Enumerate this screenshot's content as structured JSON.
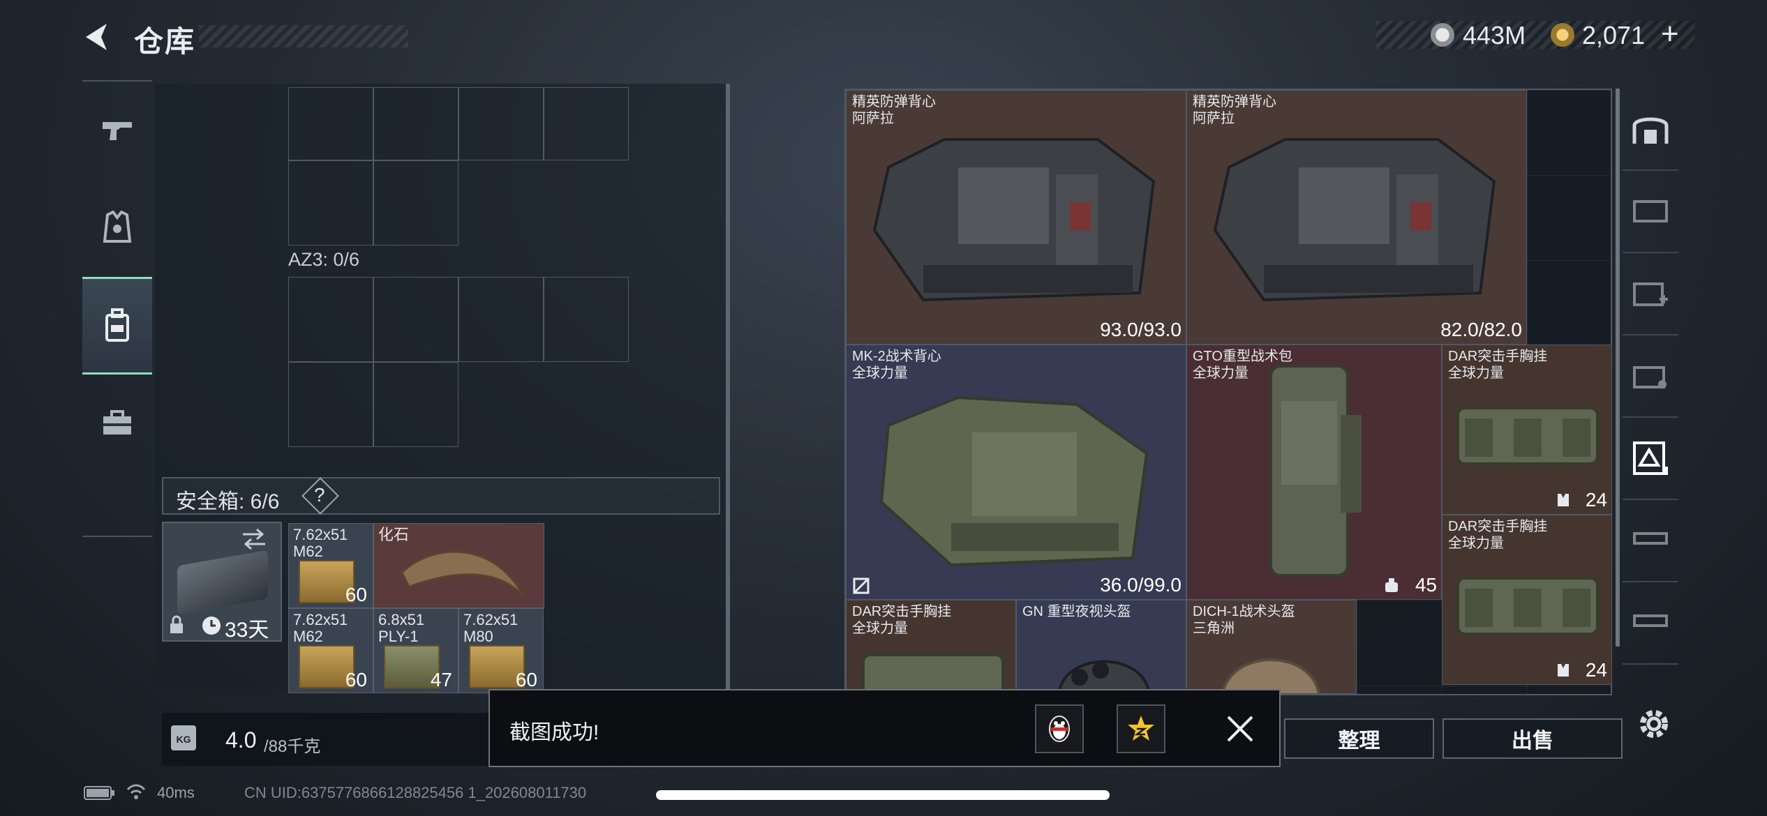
{
  "header": {
    "title": "仓库",
    "currency_1_value": "443M",
    "currency_2_value": "2,071",
    "currency_2_add": "+"
  },
  "rail": {
    "items": [
      {
        "name": "weapons",
        "icon": "gun-icon"
      },
      {
        "name": "gear",
        "icon": "vest-icon"
      },
      {
        "name": "backpack",
        "icon": "backpack-icon",
        "active": true
      },
      {
        "name": "supplies",
        "icon": "toolbox-icon"
      }
    ]
  },
  "inventory": {
    "az3_label": "AZ3: 0/6",
    "safe_label": "安全箱: 6/6",
    "help_symbol": "?",
    "secure_case_days": "33天",
    "items": [
      {
        "name": "7.62x51\nM62",
        "count": "60"
      },
      {
        "name": "化石",
        "count": ""
      },
      {
        "name": "7.62x51\nM62",
        "count": "60"
      },
      {
        "name": "6.8x51\nPLY-1",
        "count": "47"
      },
      {
        "name": "7.62x51\nM80",
        "count": "60"
      }
    ]
  },
  "weight": {
    "current": "4.0",
    "max": "/88千克",
    "icon_text": "KG"
  },
  "stash": {
    "items": [
      {
        "name": "精英防弹背心",
        "brand": "阿萨拉",
        "durability": "93.0/93.0"
      },
      {
        "name": "精英防弹背心",
        "brand": "阿萨拉",
        "durability": "82.0/82.0"
      },
      {
        "name": "MK-2战术背心",
        "brand": "全球力量",
        "durability": "36.0/99.0"
      },
      {
        "name": "GTO重型战术包",
        "brand": "全球力量",
        "count": "45"
      },
      {
        "name": "DAR突击手胸挂",
        "brand": "全球力量",
        "count": "24"
      },
      {
        "name": "DAR突击手胸挂",
        "brand": "全球力量",
        "count": "24"
      },
      {
        "name": "DAR突击手胸挂",
        "brand": "全球力量"
      },
      {
        "name": "GN 重型夜视头盔",
        "brand": ""
      },
      {
        "name": "DICH-1战术头盔",
        "brand": "三角洲"
      }
    ]
  },
  "buttons": {
    "sort": "整理",
    "sell": "出售"
  },
  "toast": {
    "message": "截图成功!"
  },
  "status": {
    "ping": "40ms",
    "uid": "CN UID:6375776866128825456 1_202608011730"
  }
}
